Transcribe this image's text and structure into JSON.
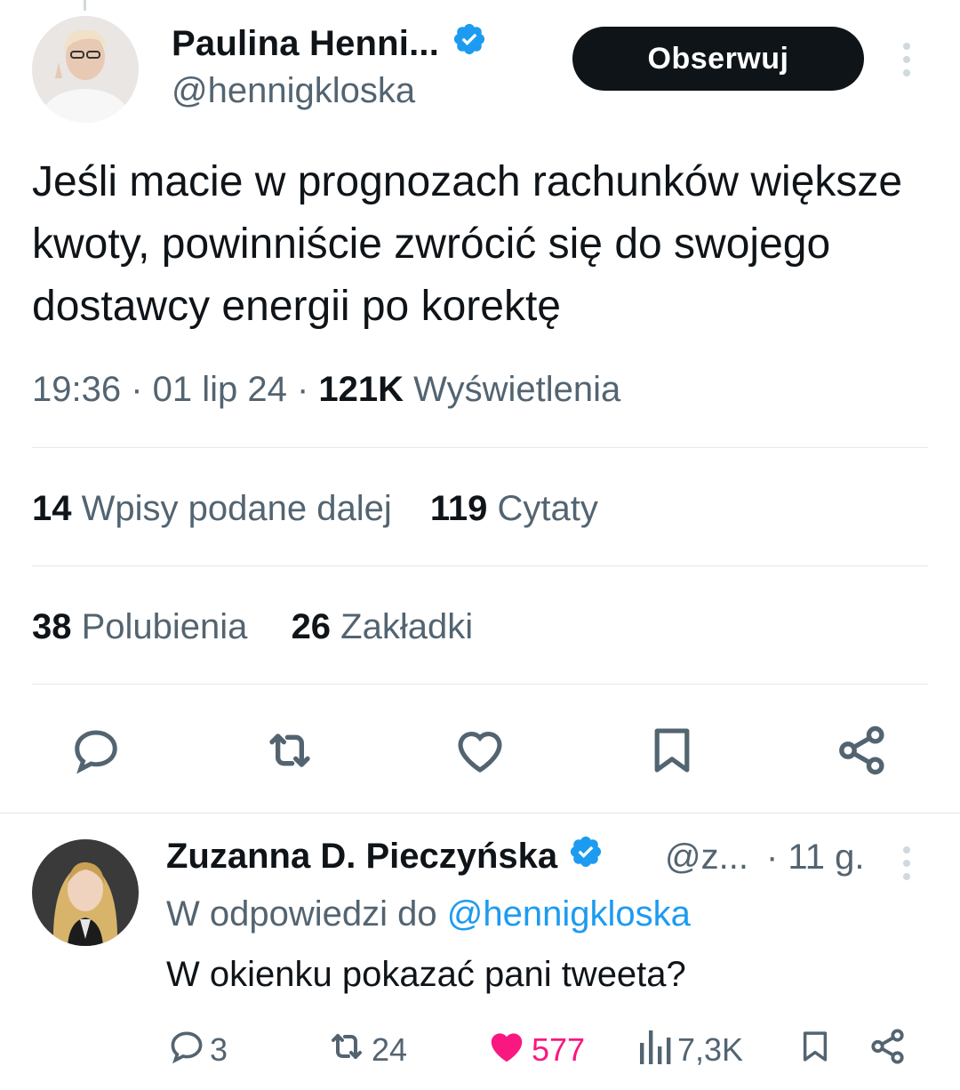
{
  "main_tweet": {
    "author_name": "Paulina Henni...",
    "handle": "@hennigkloska",
    "follow_label": "Obserwuj",
    "text": "Jeśli macie w prognozach rachunków większe kwoty, powinniście zwrócić się do swojego dostawcy energii po korektę",
    "time": "19:36 · 01 lip 24 · ",
    "views_count": "121K",
    "views_label": " Wyświetlenia",
    "stats": {
      "reposts_count": "14",
      "reposts_label": " Wpisy podane dalej",
      "quotes_count": "119",
      "quotes_label": " Cytaty",
      "likes_count": "38",
      "likes_label": " Polubienia",
      "bookmarks_count": "26",
      "bookmarks_label": " Zakładki"
    },
    "actions": [
      "reply-icon",
      "repost-icon",
      "like-icon",
      "bookmark-icon",
      "share-icon"
    ]
  },
  "reply": {
    "author_name": "Zuzanna D. Pieczyńska",
    "handle": "@z...",
    "time": "· 11 g.",
    "reply_to_prefix": "W odpowiedzi do ",
    "reply_to_mention": "@hennigkloska",
    "text": "W okienku pokazać pani tweeta?",
    "replies": "3",
    "reposts": "24",
    "likes": "577",
    "views": "7,3K"
  },
  "colors": {
    "verified": "#1d9bf0",
    "like": "#f91880",
    "secondary_text": "#536471",
    "primary_text": "#0f1419"
  }
}
